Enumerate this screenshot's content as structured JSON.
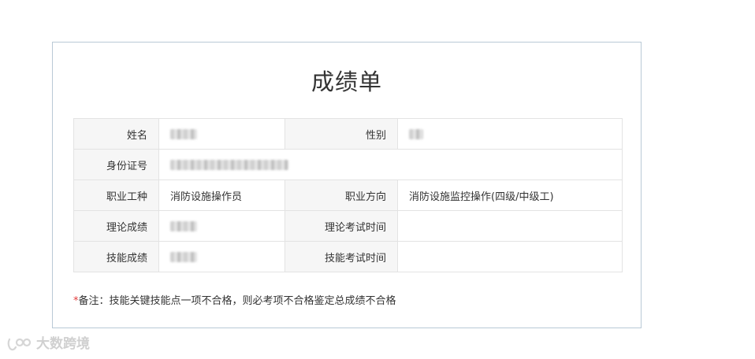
{
  "report": {
    "title": "成绩单",
    "labels": {
      "name": "姓名",
      "gender": "性别",
      "id_number": "身份证号",
      "occupation": "职业工种",
      "direction": "职业方向",
      "theory_score": "理论成绩",
      "theory_exam_time": "理论考试时间",
      "skill_score": "技能成绩",
      "skill_exam_time": "技能考试时间"
    },
    "values": {
      "occupation": "消防设施操作员",
      "direction": "消防设施监控操作(四级/中级工)",
      "theory_exam_time": "",
      "skill_exam_time": ""
    },
    "note": {
      "marker": "*",
      "text": "备注：技能关键技能点一项不合格，则必考项不合格鉴定总成绩不合格"
    }
  },
  "watermark": {
    "text": "大数跨境"
  }
}
